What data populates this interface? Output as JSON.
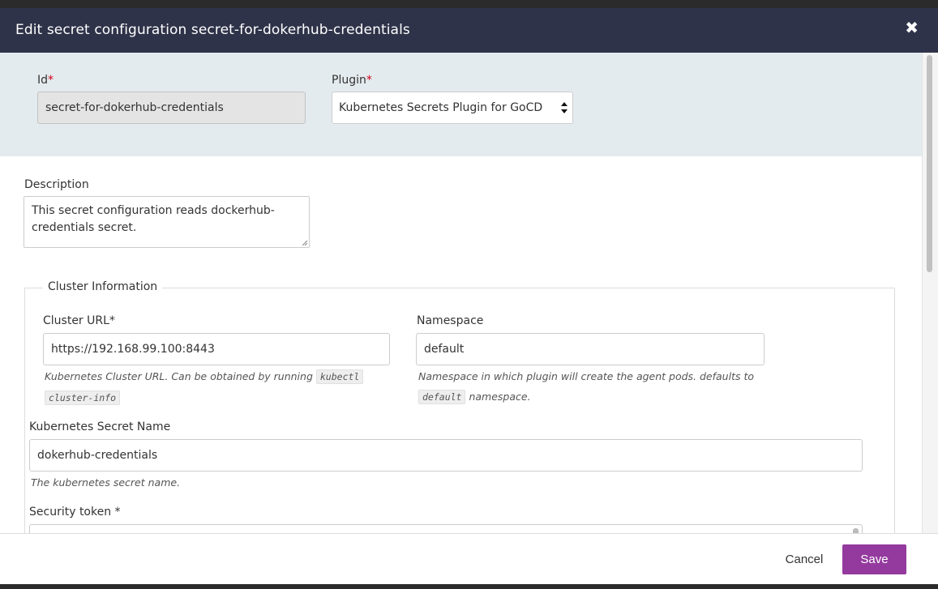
{
  "modal": {
    "title": "Edit secret configuration secret-for-dokerhub-credentials",
    "close_icon": "close-icon"
  },
  "form": {
    "id_label": "Id",
    "id_value": "secret-for-dokerhub-credentials",
    "plugin_label": "Plugin",
    "plugin_value": "Kubernetes Secrets Plugin for GoCD",
    "required_mark": "*",
    "description_label": "Description",
    "description_value": "This secret configuration reads dockerhub-credentials secret."
  },
  "cluster": {
    "legend": "Cluster Information",
    "url_label": "Cluster URL*",
    "url_value": "https://192.168.99.100:8443",
    "url_hint_prefix": "Kubernetes Cluster URL. Can be obtained by running",
    "url_hint_code_1": "kubectl",
    "url_hint_code_2": "cluster-info",
    "namespace_label": "Namespace",
    "namespace_value": "default",
    "namespace_hint_prefix": "Namespace in which plugin will create the agent pods. defaults to",
    "namespace_hint_code": "default",
    "namespace_hint_suffix": "namespace.",
    "secret_name_label": "Kubernetes Secret Name",
    "secret_name_value": "dokerhub-credentials",
    "secret_name_hint": "The kubernetes secret name.",
    "token_label": "Security token *"
  },
  "footer": {
    "cancel_label": "Cancel",
    "save_label": "Save"
  },
  "colors": {
    "header_bg": "#2f3349",
    "top_panel_bg": "#e4ebee",
    "save_bg": "#943a9e",
    "required": "#d0021b"
  }
}
